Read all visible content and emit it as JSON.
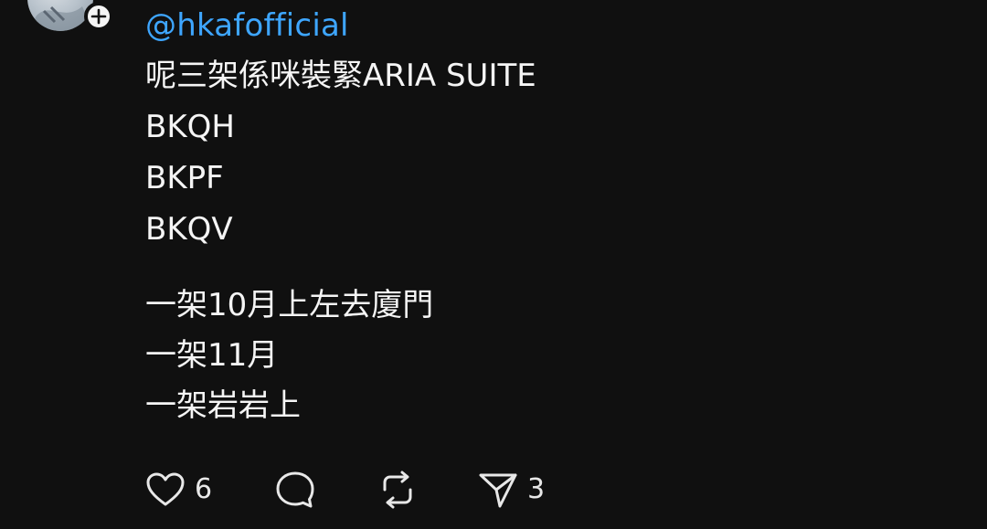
{
  "author": {
    "handle": "@hkafofficial",
    "handle_color": "#3ea6ff"
  },
  "post": {
    "lines": [
      "呢三架係咪裝緊ARIA SUITE",
      "BKQH",
      "BKPF",
      "BKQV"
    ],
    "lines2": [
      "一架10月上左去廈門",
      "一架11月",
      "一架岩岩上"
    ]
  },
  "actions": {
    "like": {
      "icon": "heart-icon",
      "count": "6"
    },
    "reply": {
      "icon": "speech-bubble-icon"
    },
    "repost": {
      "icon": "repost-icon"
    },
    "share": {
      "icon": "send-icon",
      "count": "3"
    }
  },
  "colors": {
    "background": "#101010",
    "text": "#f5f5f5",
    "accent": "#3ea6ff"
  }
}
